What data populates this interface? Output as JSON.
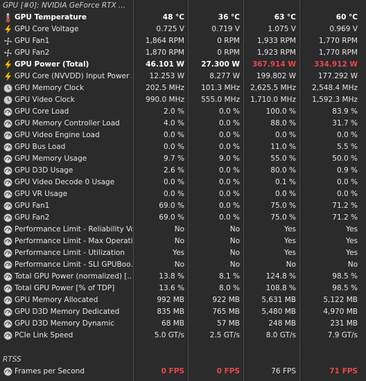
{
  "header": {
    "title": "GPU [#0]: NVIDIA GeForce RTX ..."
  },
  "rows": [
    {
      "icon": "thermometer-icon",
      "label": "GPU Temperature",
      "bold": true,
      "values": [
        "48 °C",
        "36 °C",
        "63 °C",
        "60 °C"
      ],
      "red": [
        false,
        false,
        false,
        false
      ]
    },
    {
      "icon": "lightning-icon",
      "label": "GPU Core Voltage",
      "values": [
        "0.725 V",
        "0.719 V",
        "1.075 V",
        "0.969 V"
      ]
    },
    {
      "icon": "fan-icon",
      "label": "GPU Fan1",
      "values": [
        "1,864 RPM",
        "0 RPM",
        "1,933 RPM",
        "1,770 RPM"
      ]
    },
    {
      "icon": "fan-icon",
      "label": "GPU Fan2",
      "values": [
        "1,870 RPM",
        "0 RPM",
        "1,923 RPM",
        "1,770 RPM"
      ]
    },
    {
      "icon": "lightning-icon",
      "label": "GPU Power (Total)",
      "bold": true,
      "values": [
        "46.101 W",
        "27.300 W",
        "367.914 W",
        "334.912 W"
      ],
      "red": [
        false,
        false,
        true,
        true
      ]
    },
    {
      "icon": "lightning-icon",
      "label": "GPU Core (NVVDD) Input Power ...",
      "values": [
        "12.253 W",
        "8.277 W",
        "199.802 W",
        "177.292 W"
      ]
    },
    {
      "icon": "clock-icon",
      "label": "GPU Memory Clock",
      "values": [
        "202.5 MHz",
        "101.3 MHz",
        "2,625.5 MHz",
        "2,548.4 MHz"
      ]
    },
    {
      "icon": "clock-icon",
      "label": "GPU Video Clock",
      "values": [
        "990.0 MHz",
        "555.0 MHz",
        "1,710.0 MHz",
        "1,592.3 MHz"
      ]
    },
    {
      "icon": "gauge-icon",
      "label": "GPU Core Load",
      "values": [
        "2.0 %",
        "0.0 %",
        "100.0 %",
        "83.9 %"
      ]
    },
    {
      "icon": "gauge-icon",
      "label": "GPU Memory Controller Load",
      "values": [
        "4.0 %",
        "0.0 %",
        "88.0 %",
        "31.7 %"
      ]
    },
    {
      "icon": "gauge-icon",
      "label": "GPU Video Engine Load",
      "values": [
        "0.0 %",
        "0.0 %",
        "0.0 %",
        "0.0 %"
      ]
    },
    {
      "icon": "gauge-icon",
      "label": "GPU Bus Load",
      "values": [
        "0.0 %",
        "0.0 %",
        "11.0 %",
        "5.5 %"
      ]
    },
    {
      "icon": "gauge-icon",
      "label": "GPU Memory Usage",
      "values": [
        "9.7 %",
        "9.0 %",
        "55.0 %",
        "50.0 %"
      ]
    },
    {
      "icon": "gauge-icon",
      "label": "GPU D3D Usage",
      "values": [
        "2.6 %",
        "0.0 %",
        "80.0 %",
        "0.9 %"
      ]
    },
    {
      "icon": "gauge-icon",
      "label": "GPU Video Decode 0 Usage",
      "values": [
        "0.0 %",
        "0.0 %",
        "0.1 %",
        "0.0 %"
      ]
    },
    {
      "icon": "gauge-icon",
      "label": "GPU VR Usage",
      "values": [
        "0.0 %",
        "0.0 %",
        "0.0 %",
        "0.0 %"
      ]
    },
    {
      "icon": "gauge-icon",
      "label": "GPU Fan1",
      "values": [
        "69.0 %",
        "0.0 %",
        "75.0 %",
        "71.2 %"
      ]
    },
    {
      "icon": "gauge-icon",
      "label": "GPU Fan2",
      "values": [
        "69.0 %",
        "0.0 %",
        "75.0 %",
        "71.2 %"
      ]
    },
    {
      "icon": "gauge-icon",
      "label": "Performance Limit - Reliability Vo...",
      "values": [
        "No",
        "No",
        "Yes",
        "Yes"
      ]
    },
    {
      "icon": "gauge-icon",
      "label": "Performance Limit - Max Operati...",
      "values": [
        "No",
        "No",
        "Yes",
        "Yes"
      ]
    },
    {
      "icon": "gauge-icon",
      "label": "Performance Limit - Utilization",
      "values": [
        "Yes",
        "No",
        "Yes",
        "Yes"
      ]
    },
    {
      "icon": "gauge-icon",
      "label": "Performance Limit - SLI GPUBoo...",
      "values": [
        "No",
        "No",
        "No",
        "No"
      ]
    },
    {
      "icon": "gauge-icon",
      "label": "Total GPU Power (normalized) [...",
      "values": [
        "13.8 %",
        "8.1 %",
        "124.8 %",
        "98.5 %"
      ]
    },
    {
      "icon": "gauge-icon",
      "label": "Total GPU Power [% of TDP]",
      "values": [
        "13.6 %",
        "8.0 %",
        "108.8 %",
        "98.5 %"
      ]
    },
    {
      "icon": "gauge-icon",
      "label": "GPU Memory Allocated",
      "values": [
        "992 MB",
        "922 MB",
        "5,631 MB",
        "5,122 MB"
      ]
    },
    {
      "icon": "gauge-icon",
      "label": "GPU D3D Memory Dedicated",
      "values": [
        "835 MB",
        "765 MB",
        "5,480 MB",
        "4,970 MB"
      ]
    },
    {
      "icon": "gauge-icon",
      "label": "GPU D3D Memory Dynamic",
      "values": [
        "68 MB",
        "57 MB",
        "248 MB",
        "231 MB"
      ]
    },
    {
      "icon": "gauge-icon",
      "label": "PCIe Link Speed",
      "values": [
        "5.0 GT/s",
        "2.5 GT/s",
        "8.0 GT/s",
        "7.9 GT/s"
      ]
    }
  ],
  "section2": {
    "title": "RTSS"
  },
  "fps_row": {
    "icon": "gauge-icon",
    "label": "Frames per Second",
    "values": [
      "0 FPS",
      "0 FPS",
      "76 FPS",
      "71 FPS"
    ],
    "red": [
      true,
      true,
      false,
      true
    ]
  },
  "colors": {
    "background": "#2b2b2b",
    "accent_red": "#e8474b",
    "text": "#e6e6e6",
    "icon_yellow": "#f2c200"
  }
}
